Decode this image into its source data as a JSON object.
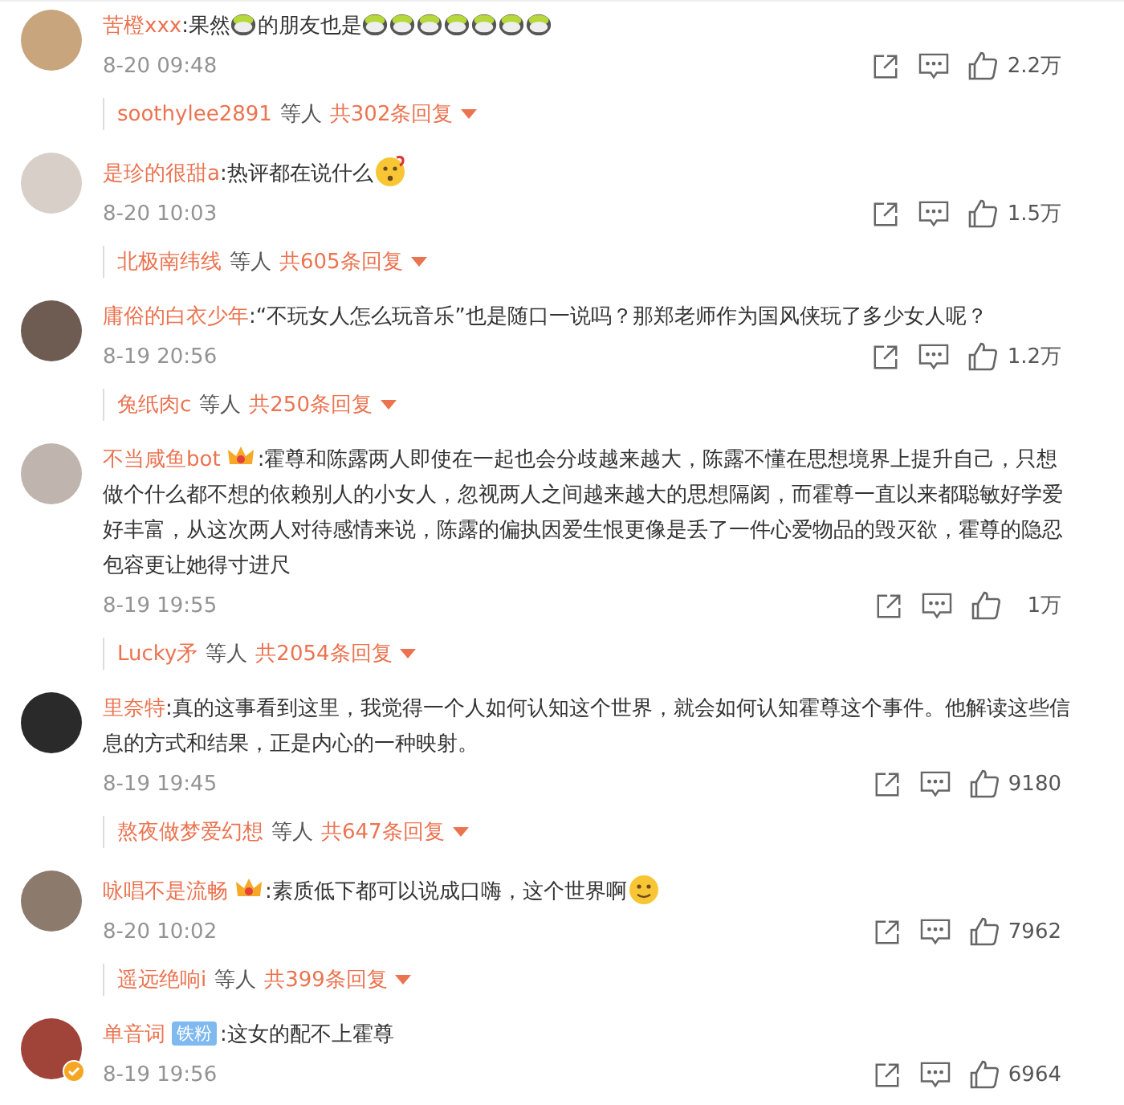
{
  "comments": [
    {
      "username": "苦橙xxx",
      "verified": false,
      "segments": [
        {
          "kind": "text",
          "text": ":果然"
        },
        {
          "kind": "cup-emoji"
        },
        {
          "kind": "text",
          "text": "的朋友也是"
        },
        {
          "kind": "cup-emoji"
        },
        {
          "kind": "cup-emoji"
        },
        {
          "kind": "cup-emoji"
        },
        {
          "kind": "cup-emoji"
        },
        {
          "kind": "cup-emoji"
        },
        {
          "kind": "cup-emoji"
        },
        {
          "kind": "cup-emoji"
        }
      ],
      "date": "8-20 09:48",
      "likes": "2.2万",
      "replies": {
        "user": "soothylee2891",
        "others": "等人",
        "count": "共302条回复"
      }
    },
    {
      "username": "是珍的很甜a",
      "verified": false,
      "segments": [
        {
          "kind": "text",
          "text": ":热评都在说什么"
        },
        {
          "kind": "puzzled-emoji"
        }
      ],
      "date": "8-20 10:03",
      "likes": "1.5万",
      "replies": {
        "user": "北极南纬线",
        "others": "等人",
        "count": "共605条回复"
      }
    },
    {
      "username": "庸俗的白衣少年",
      "verified": false,
      "segments": [
        {
          "kind": "text",
          "text": ":“不玩女人怎么玩音乐”也是随口一说吗？那郑老师作为国风侠玩了多少女人呢？"
        }
      ],
      "date": "8-19 20:56",
      "likes": "1.2万",
      "replies": {
        "user": "兔纸肉c",
        "others": "等人",
        "count": "共250条回复"
      }
    },
    {
      "username": "不当咸鱼bot",
      "verified": false,
      "badge": {
        "kind": "crown"
      },
      "segments": [
        {
          "kind": "text",
          "text": ":霍尊和陈露两人即使在一起也会分歧越来越大，陈露不懂在思想境界上提升自己，只想做个什么都不想的依赖别人的小女人，忽视两人之间越来越大的思想隔阂，而霍尊一直以来都聪敏好学爱好丰富，从这次两人对待感情来说，陈露的偏执因爱生恨更像是丢了一件心爱物品的毁灭欲，霍尊的隐忍包容更让她得寸进尺"
        }
      ],
      "date": "8-19 19:55",
      "likes": "1万",
      "replies": {
        "user": "Lucky矛",
        "others": "等人",
        "count": "共2054条回复"
      }
    },
    {
      "username": "里奈特",
      "verified": false,
      "segments": [
        {
          "kind": "text",
          "text": ":真的这事看到这里，我觉得一个人如何认知这个世界，就会如何认知霍尊这个事件。他解读这些信息的方式和结果，正是内心的一种映射。"
        }
      ],
      "date": "8-19 19:45",
      "likes": "9180",
      "replies": {
        "user": "熬夜做梦爱幻想",
        "others": "等人",
        "count": "共647条回复"
      }
    },
    {
      "username": "咏唱不是流畅",
      "verified": false,
      "badge": {
        "kind": "crown"
      },
      "segments": [
        {
          "kind": "text",
          "text": ":素质低下都可以说成口嗨，这个世界啊"
        },
        {
          "kind": "smile-emoji"
        }
      ],
      "date": "8-20 10:02",
      "likes": "7962",
      "replies": {
        "user": "遥远绝响i",
        "others": "等人",
        "count": "共399条回复"
      }
    },
    {
      "username": "单音词",
      "verified": true,
      "badge": {
        "kind": "tag",
        "text": "铁粉"
      },
      "segments": [
        {
          "kind": "text",
          "text": ":这女的配不上霍尊"
        }
      ],
      "date": "8-19 19:56",
      "likes": "6964"
    }
  ]
}
